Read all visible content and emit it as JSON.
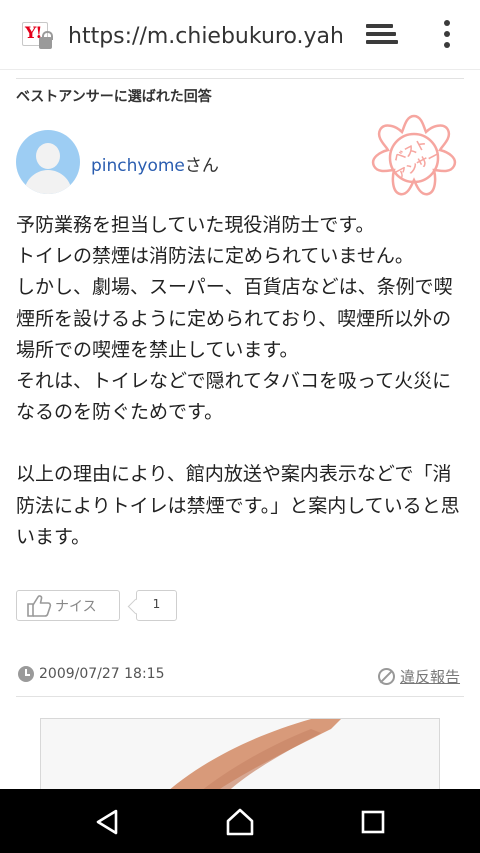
{
  "browser": {
    "url": "https://m.chiebukuro.yahoo.co.jp",
    "site_icon": "yahoo-favicon",
    "site_icon_text": "Y!",
    "tabs_icon": "tabs-icon",
    "menu_icon": "overflow-menu-icon"
  },
  "answer_section": {
    "title": "ベストアンサーに選ばれた回答",
    "badge_icon": "best-answer-seal-icon",
    "badge_text": "ベスト\nアンサー",
    "answerer": {
      "name": "pinchyome",
      "suffix": "さん",
      "avatar_icon": "default-avatar-icon"
    },
    "body_paragraphs": [
      "予防業務を担当していた現役消防士です。\nトイレの禁煙は消防法に定められていません。\nしかし、劇場、スーパー、百貨店などは、条例で喫煙所を設けるように定められており、喫煙所以外の場所での喫煙を禁止しています。\nそれは、トイレなどで隠れてタバコを吸って火災になるのを防ぐためです。",
      "以上の理由により、館内放送や案内表示などで「消防法によりトイレは禁煙です。」と案内していると思います。"
    ],
    "nice_button": {
      "label": "ナイス",
      "count": "1",
      "icon": "thumbs-up-icon"
    },
    "timestamp": "2009/07/27 18:15",
    "clock_icon": "clock-icon",
    "report": {
      "label": "違反報告",
      "icon": "prohibited-icon"
    }
  },
  "navigation_bar": {
    "back_icon": "back-triangle-icon",
    "home_icon": "home-icon",
    "recents_icon": "recents-square-icon"
  },
  "colors": {
    "link": "#2a5db0",
    "avatar_bg": "#9dcdf3",
    "badge": "#f6a6a0",
    "brand_red": "#e4001b",
    "navbar": "#000000"
  }
}
